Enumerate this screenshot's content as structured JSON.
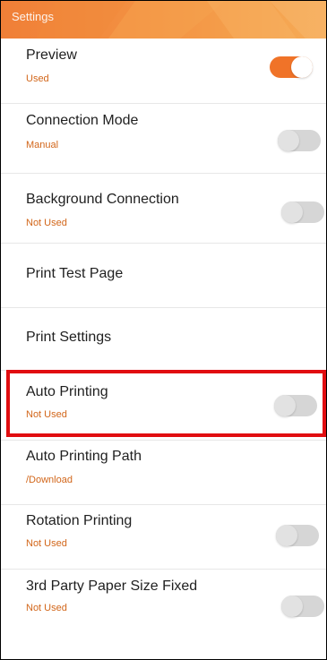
{
  "header": {
    "title": "Settings"
  },
  "colors": {
    "accent": "#f07328",
    "subtitle": "#d2661a",
    "highlight": "#e10d10",
    "toggle_off": "#d6d6d6"
  },
  "settings": [
    {
      "title": "Preview",
      "subtitle": "Used",
      "toggle": true,
      "toggle_on": true
    },
    {
      "title": "Connection Mode",
      "subtitle": "Manual",
      "toggle": true,
      "toggle_on": false
    },
    {
      "title": "Background Connection",
      "subtitle": "Not Used",
      "toggle": true,
      "toggle_on": false
    },
    {
      "title": "Print Test Page",
      "subtitle": "",
      "toggle": false
    },
    {
      "title": "Print Settings",
      "subtitle": "",
      "toggle": false
    },
    {
      "title": "Auto Printing",
      "subtitle": "Not Used",
      "toggle": true,
      "toggle_on": false,
      "highlighted": true
    },
    {
      "title": "Auto Printing Path",
      "subtitle": "/Download",
      "toggle": false
    },
    {
      "title": "Rotation Printing",
      "subtitle": "Not Used",
      "toggle": true,
      "toggle_on": false
    },
    {
      "title": "3rd Party Paper Size Fixed",
      "subtitle": "Not Used",
      "toggle": true,
      "toggle_on": false
    }
  ]
}
